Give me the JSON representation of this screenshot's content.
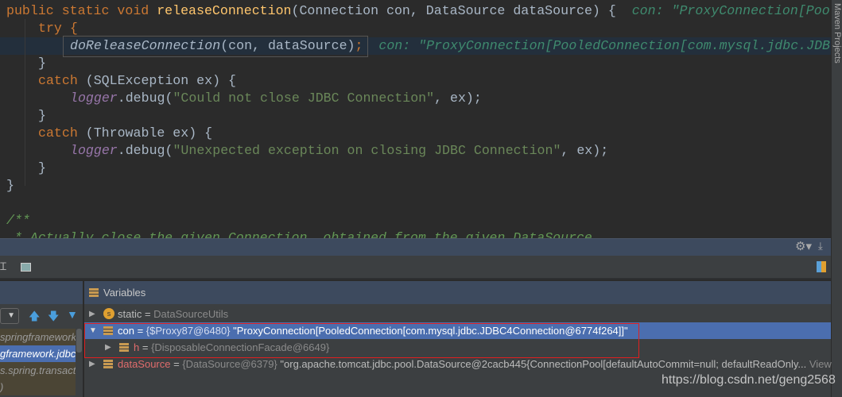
{
  "editor": {
    "line1": {
      "kw": "public static void ",
      "fn": "releaseConnection",
      "rest": "(Connection con, DataSource dataSource) {",
      "hint": "con: \"ProxyConnection[Poo"
    },
    "line2": "try {",
    "line3": {
      "call": "doReleaseConnection",
      "args": "(con, dataSource)",
      "semi": ";",
      "hint": "con: \"ProxyConnection[PooledConnection[com.mysql.jdbc.JDB"
    },
    "line4": "}",
    "line5": {
      "kw": "catch ",
      "rest": "(SQLException ex) {"
    },
    "line6": {
      "obj": "logger",
      "mid": ".debug(",
      "str": "\"Could not close JDBC Connection\"",
      "end": ", ex);"
    },
    "line7": "}",
    "line8": {
      "kw": "catch ",
      "rest": "(Throwable ex) {"
    },
    "line9": {
      "obj": "logger",
      "mid": ".debug(",
      "str": "\"Unexpected exception on closing JDBC Connection\"",
      "end": ", ex);"
    },
    "line10": "}",
    "line11": "}",
    "line12": "/**",
    "line13": " * Actually close the given Connection, obtained from the given DataSource."
  },
  "side_tool": "Maven Projects",
  "frames": {
    "items": [
      "springframework.j",
      "gframework.jdbc",
      "s.spring.transact",
      ")"
    ],
    "selected": 1
  },
  "variables": {
    "title": "Variables",
    "rows": [
      {
        "name": "static",
        "eq": " = ",
        "value": "DataSourceUtils",
        "icon": "static-icon"
      },
      {
        "name": "con",
        "eq": " = ",
        "ref": "{$Proxy87@6480}",
        "value": " \"ProxyConnection[PooledConnection[com.mysql.jdbc.JDBC4Connection@6774f264]]\""
      },
      {
        "name": "h",
        "eq": " = ",
        "ref": "{DisposableConnectionFacade@6649}"
      },
      {
        "name": "dataSource",
        "eq": " = ",
        "ref": "{DataSource@6379}",
        "value": " \"org.apache.tomcat.jdbc.pool.DataSource@2cacb445{ConnectionPool[defaultAutoCommit=null; defaultReadOnly...",
        "view": "View"
      }
    ]
  },
  "watermark": "https://blog.csdn.net/geng2568"
}
